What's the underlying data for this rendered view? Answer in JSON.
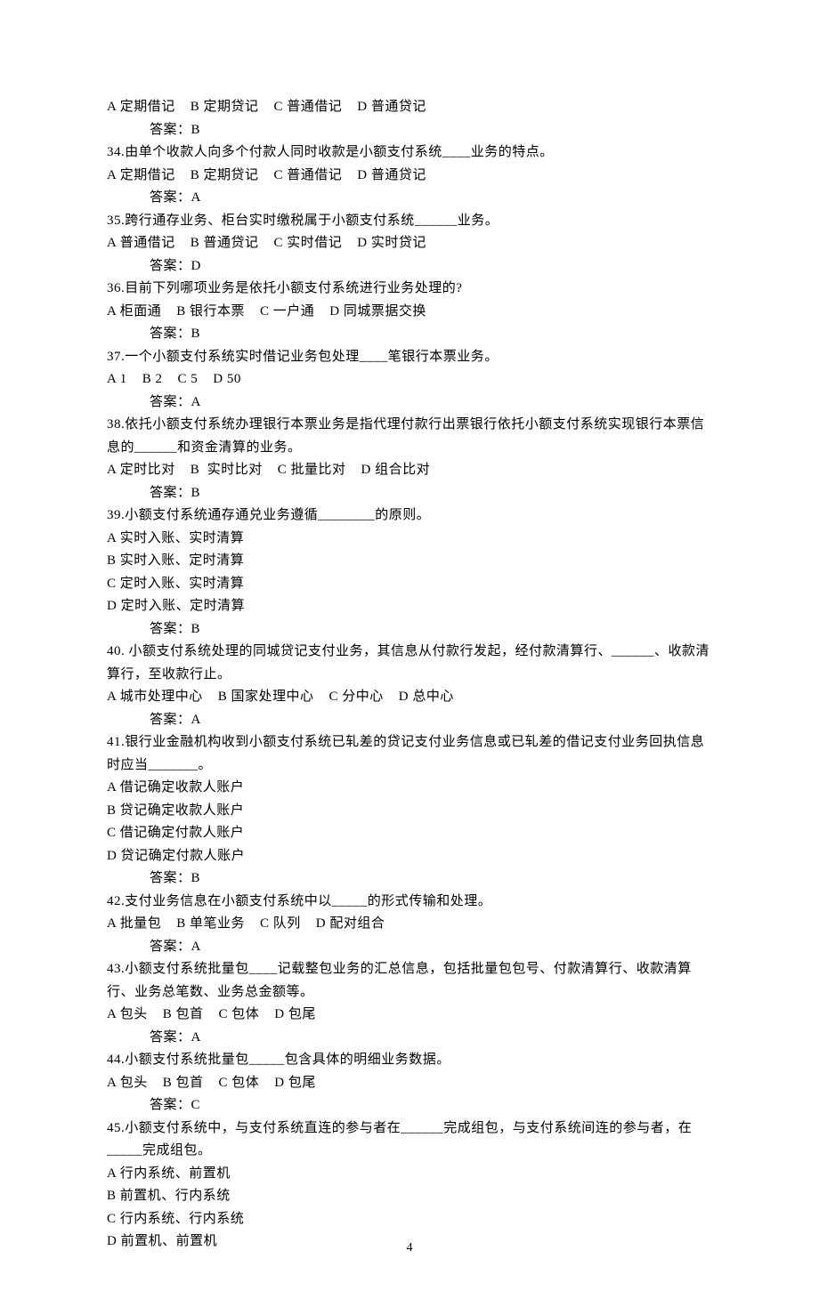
{
  "page_number": "4",
  "questions": [
    {
      "options_inline": "A 定期借记    B 定期贷记    C 普通借记    D 普通贷记",
      "answer": "答案：B"
    },
    {
      "text": "34.由单个收款人向多个付款人同时收款是小额支付系统____业务的特点。",
      "options_inline": "A 定期借记    B 定期贷记    C 普通借记    D 普通贷记",
      "answer": "答案：A"
    },
    {
      "text": "35.跨行通存业务、柜台实时缴税属于小额支付系统______业务。",
      "options_inline": "A 普通借记    B 普通贷记    C 实时借记    D 实时贷记",
      "answer": "答案：D"
    },
    {
      "text": "36.目前下列哪项业务是依托小额支付系统进行业务处理的?",
      "options_inline": "A 柜面通    B 银行本票    C 一户通    D 同城票据交换",
      "answer": "答案：B"
    },
    {
      "text": "37.一个小额支付系统实时借记业务包处理____笔银行本票业务。",
      "options_inline": "A 1    B 2    C 5    D 50",
      "answer": "答案：A"
    },
    {
      "text": "38.依托小额支付系统办理银行本票业务是指代理付款行出票银行依托小额支付系统实现银行本票信息的______和资金清算的业务。",
      "options_inline": "A 定时比对    B  实时比对    C 批量比对    D 组合比对",
      "answer": "答案：B"
    },
    {
      "text": "39.小额支付系统通存通兑业务遵循________的原则。",
      "options_lines": [
        "A 实时入账、实时清算",
        "B 实时入账、定时清算",
        "C 定时入账、实时清算",
        "D 定时入账、定时清算"
      ],
      "answer": "答案：B"
    },
    {
      "text": "40. 小额支付系统处理的同城贷记支付业务，其信息从付款行发起，经付款清算行、______、收款清算行，至收款行止。",
      "options_inline": "A 城市处理中心    B 国家处理中心    C 分中心    D 总中心",
      "answer": "答案：A"
    },
    {
      "text": "41.银行业金融机构收到小额支付系统已轧差的贷记支付业务信息或已轧差的借记支付业务回执信息时应当_______。",
      "options_lines": [
        "A 借记确定收款人账户",
        "B 贷记确定收款人账户",
        "C 借记确定付款人账户",
        "D 贷记确定付款人账户"
      ],
      "answer": "答案：B"
    },
    {
      "text": "42.支付业务信息在小额支付系统中以_____的形式传输和处理。",
      "options_inline": "A 批量包    B 单笔业务    C 队列    D 配对组合",
      "answer": "答案：A"
    },
    {
      "text": "43.小额支付系统批量包____记载整包业务的汇总信息，包括批量包包号、付款清算行、收款清算行、业务总笔数、业务总金额等。",
      "options_inline": "A 包头    B 包首    C 包体    D 包尾",
      "answer": "答案：A"
    },
    {
      "text": "44.小额支付系统批量包_____包含具体的明细业务数据。",
      "options_inline": "A 包头    B 包首    C 包体    D 包尾",
      "answer": "答案：C"
    },
    {
      "text": "45.小额支付系统中，与支付系统直连的参与者在______完成组包，与支付系统间连的参与者，在_____完成组包。",
      "options_lines": [
        "A 行内系统、前置机",
        "B 前置机、行内系统",
        "C 行内系统、行内系统",
        "D 前置机、前置机"
      ]
    }
  ]
}
